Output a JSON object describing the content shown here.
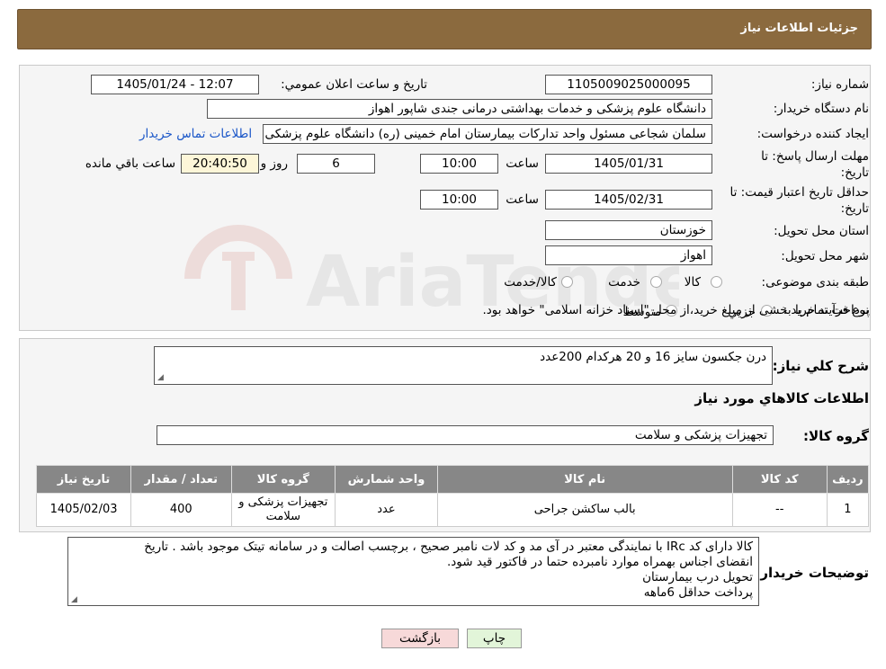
{
  "header": {
    "title": "جزئیات اطلاعات نیاز"
  },
  "form": {
    "need_number_label": "شماره نیاز:",
    "need_number": "1105009025000095",
    "announce_label": "تاریخ و ساعت اعلان عمومي:",
    "announce_value": "1405/01/24 - 12:07",
    "buyer_org_label": "نام دستگاه خريدار:",
    "buyer_org": "دانشگاه علوم پزشکی و خدمات بهداشتی درمانی جندی شاپور اهواز",
    "requester_label": "ايجاد کننده درخواست:",
    "requester": "سلمان شجاعی مسئول واحد تداركات بیمارستان امام خمینی (ره) دانشگاه علوم پزشکی جندی شاپور اهواز",
    "contact_link": "اطلاعات تماس خريدار",
    "deadline_label_1": "مهلت ارسال پاسخ: تا",
    "deadline_label_2": "تاريخ:",
    "deadline_date": "1405/01/31",
    "time_label": "ساعت",
    "deadline_time": "10:00",
    "days_value": "6",
    "days_label": "روز و",
    "countdown": "20:40:50",
    "remaining_label": "ساعت باقي مانده",
    "validity_label_1": "حداقل تاريخ اعتبار قيمت: تا",
    "validity_label_2": "تاريخ:",
    "validity_date": "1405/02/31",
    "validity_time": "10:00",
    "province_label": "استان محل تحويل:",
    "province": "خوزستان",
    "city_label": "شهر محل تحويل:",
    "city": "اهواز",
    "category_label": "طبقه بندی موضوعی:",
    "category_options": [
      "کالا",
      "خدمت",
      "کالا/خدمت"
    ],
    "process_label": "نوع فرآيند خريد :",
    "process_options": [
      "جزيي",
      "متوسط"
    ],
    "process_note": "پرداخت تمام يا بخشی از مبلغ خريد،از محل \"اسناد خزانه اسلامی\" خواهد بود."
  },
  "summary": {
    "desc_label": "شرح کلي نياز:",
    "desc_value": "درن جکسون  سایز 16 و 20      هرکدام 200عدد",
    "items_title": "اطلاعات کالاهاي مورد نياز",
    "group_label": "گروه کالا:",
    "group_value": "تجهیزات پزشکی و سلامت"
  },
  "table": {
    "headers": [
      "رديف",
      "کد کالا",
      "نام کالا",
      "واحد شمارش",
      "گروه کالا",
      "تعداد / مقدار",
      "تاريخ نياز"
    ],
    "rows": [
      [
        "1",
        "--",
        "بالب ساکشن جراحی",
        "عدد",
        "تجهیزات پزشکی و سلامت",
        "400",
        "1405/02/03"
      ]
    ]
  },
  "buyer_notes": {
    "label": "توضيحات خريدار:",
    "lines": [
      "کالا دارای کد IRc با نمایندگی معتبر در آی مد و کد لات نامبر صحیح ، برچسب اصالت و در سامانه تیتک موجود باشد . تاریخ",
      "انقضای اجناس بهمراه موارد نامبرده حتما در فاکتور قید شود.",
      "تحویل درب بیمارستان",
      "پرداخت حداقل 6ماهه"
    ]
  },
  "buttons": {
    "print": "چاپ",
    "back": "بازگشت"
  },
  "watermark": {
    "text": "AriaTender.neT"
  },
  "colors": {
    "header": "#8b6a3e",
    "table_header": "#878787",
    "back_button": "#f7d9d9",
    "print_button": "#e2f5d9",
    "link": "#1a56c8"
  }
}
